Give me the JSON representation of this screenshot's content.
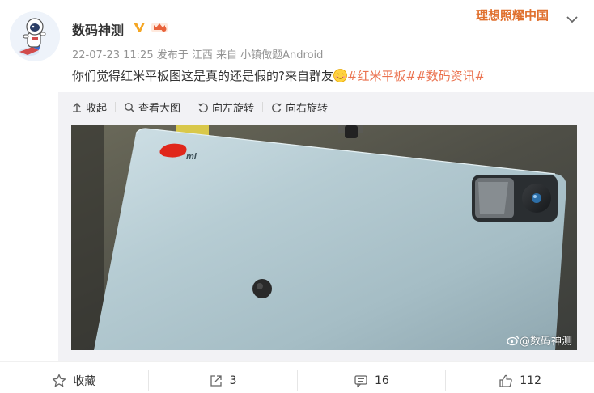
{
  "post": {
    "author": "数码神测",
    "top_watermark": "理想照耀中国",
    "meta": {
      "time": "22-07-23 11:25",
      "location": "发布于 江西",
      "source": "来自 小镇做题Android"
    },
    "text": "你们觉得红米平板图这是真的还是假的?来自群友",
    "tags": [
      "#红米平板#",
      "#数码资讯#"
    ]
  },
  "toolbar": {
    "collapse": "收起",
    "view_large": "查看大图",
    "rotate_left": "向左旋转",
    "rotate_right": "向右旋转"
  },
  "photo": {
    "watermark": "@数码神测",
    "logo_text": "mi"
  },
  "footer": {
    "favorite": "收藏",
    "share_count": "3",
    "comment_count": "16",
    "like_count": "112"
  },
  "colors": {
    "tag": "#eb7350",
    "watermark": "#e0712f",
    "verified": "#f5a623"
  }
}
